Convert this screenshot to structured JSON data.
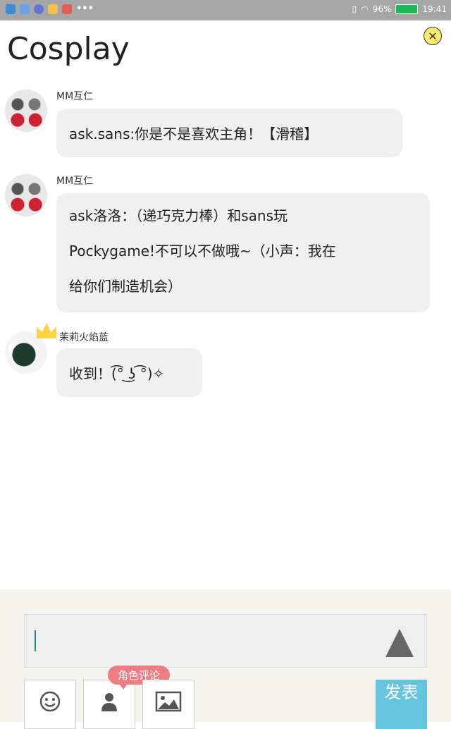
{
  "status_bar": {
    "time": "19:41",
    "battery": "96%",
    "overflow": "•••"
  },
  "header": {
    "title": "Cosplay",
    "close_symbol": "✕"
  },
  "messages": [
    {
      "user": "MM互仁",
      "lines": [
        "ask.sans:你是不是喜欢主角！【滑稽】"
      ]
    },
    {
      "user": "MM互仁",
      "lines": [
        "ask洛洛：（递巧克力棒）和sans玩",
        "Pockygame!不可以不做哦~（小声：我在",
        "给你们制造机会）"
      ]
    },
    {
      "user": "茉莉火焰蓝",
      "lines": [
        "收到！(͡° ͜ʖ ͡°)✧"
      ]
    }
  ],
  "composer": {
    "input_value": "",
    "badge_label": "角色评论",
    "publish_label": "发表",
    "icons": [
      "emoji-icon",
      "person-icon",
      "image-icon",
      "send-triangle-icon"
    ]
  },
  "colors": {
    "status_bar": "#a6a6a6",
    "bubble": "#f0f0f0",
    "composer_bg": "#f5f4ee",
    "publish": "#66c4dc",
    "badge": "#ee7c84",
    "close_button": "#ffeb6b"
  }
}
